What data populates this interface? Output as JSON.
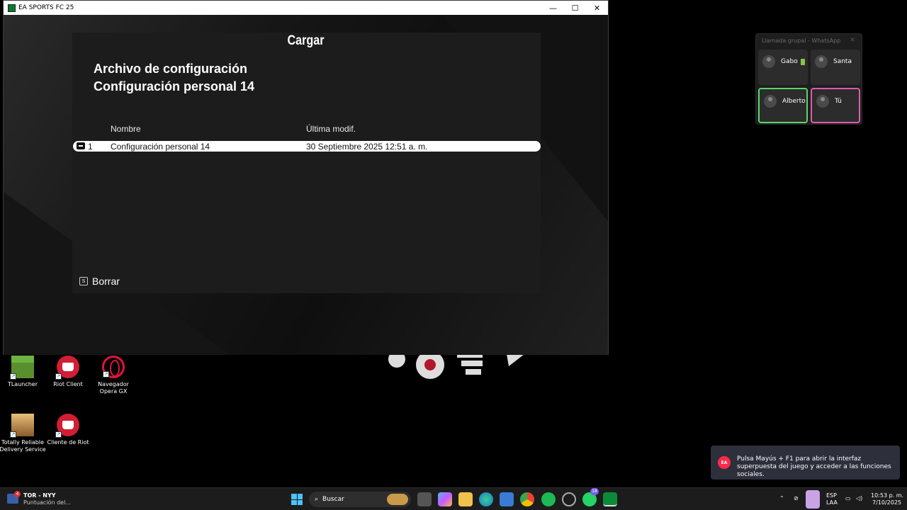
{
  "window": {
    "title": "EA SPORTS FC 25",
    "minimize": "—",
    "maximize": "☐",
    "close": "✕"
  },
  "panel": {
    "title": "Cargar",
    "heading": "Archivo de configuración",
    "subheading": "Configuración personal 14",
    "columns": {
      "name": "Nombre",
      "modified": "Última modif."
    },
    "rows": [
      {
        "index": "1",
        "name": "Configuración personal 14",
        "modified": "30 Septiembre 2025 12:51 a. m."
      }
    ],
    "delete_key": "S",
    "delete_label": "Borrar"
  },
  "desktop": {
    "icons": [
      {
        "label": "TLauncher"
      },
      {
        "label": "Riot Client"
      },
      {
        "label": "Navegador Opera GX"
      },
      {
        "label": "Totally Reliable Delivery Service"
      },
      {
        "label": "Cliente de Riot"
      }
    ]
  },
  "whatsapp": {
    "title": "Llamada grupal - WhatsApp",
    "close": "✕",
    "participants": [
      {
        "name": "Gabo",
        "border": "none"
      },
      {
        "name": "Santa",
        "border": "none"
      },
      {
        "name": "Alberto",
        "border": "#5ad66b"
      },
      {
        "name": "Tú",
        "border": "#e05ab0"
      }
    ]
  },
  "toast": {
    "logo": "EA",
    "text": "Pulsa Mayús + F1 para abrir la interfaz superpuesta del juego y acceder a las funciones sociales."
  },
  "taskbar": {
    "weather_badge": "4",
    "game_title": "TOR - NYY",
    "game_sub": "Puntuación del...",
    "search_placeholder": "Buscar",
    "whatsapp_badge": "18",
    "lang": "ESP",
    "layout": "LAA",
    "time": "10:53 p. m.",
    "date": "7/10/2025"
  }
}
